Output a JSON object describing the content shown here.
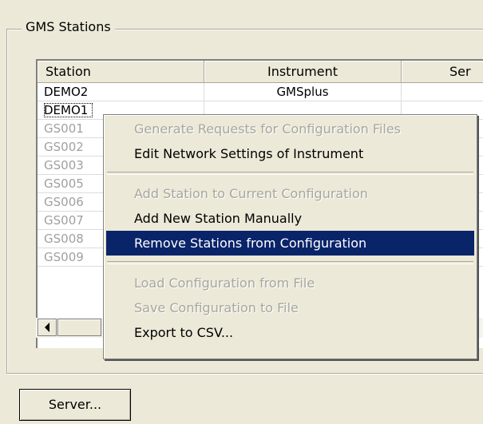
{
  "groupbox": {
    "title": "GMS Stations"
  },
  "table": {
    "columns": [
      "Station",
      "Instrument",
      "Ser"
    ],
    "rows": [
      {
        "station": "DEMO2",
        "instrument": "GMSplus",
        "server": ""
      },
      {
        "station": "DEMO1",
        "instrument": "",
        "server": ""
      },
      {
        "station": "GS001",
        "instrument": "",
        "server": ""
      },
      {
        "station": "GS002",
        "instrument": "",
        "server": ""
      },
      {
        "station": "GS003",
        "instrument": "",
        "server": ""
      },
      {
        "station": "GS005",
        "instrument": "",
        "server": ""
      },
      {
        "station": "GS006",
        "instrument": "",
        "server": ""
      },
      {
        "station": "GS007",
        "instrument": "",
        "server": ""
      },
      {
        "station": "GS008",
        "instrument": "",
        "server": ""
      },
      {
        "station": "GS009",
        "instrument": "",
        "server": ""
      }
    ]
  },
  "scrollbar": {
    "left_arrow_icon": "triangle-left-icon"
  },
  "context_menu": {
    "groups": [
      [
        {
          "label": "Generate Requests for Configuration Files",
          "enabled": false
        },
        {
          "label": "Edit Network Settings of Instrument",
          "enabled": true
        }
      ],
      [
        {
          "label": "Add Station to Current Configuration",
          "enabled": false
        },
        {
          "label": "Add New Station Manually",
          "enabled": true
        },
        {
          "label": "Remove Stations from Configuration",
          "enabled": true,
          "highlighted": true
        }
      ],
      [
        {
          "label": "Load Configuration from File",
          "enabled": false
        },
        {
          "label": "Save Configuration to File",
          "enabled": false
        },
        {
          "label": "Export to CSV...",
          "enabled": true
        }
      ]
    ]
  },
  "buttons": {
    "server_label": "Server..."
  },
  "colors": {
    "window_bg": "#ece9d8",
    "highlight_bg": "#0a246a",
    "disabled_text": "#a7a69e"
  }
}
